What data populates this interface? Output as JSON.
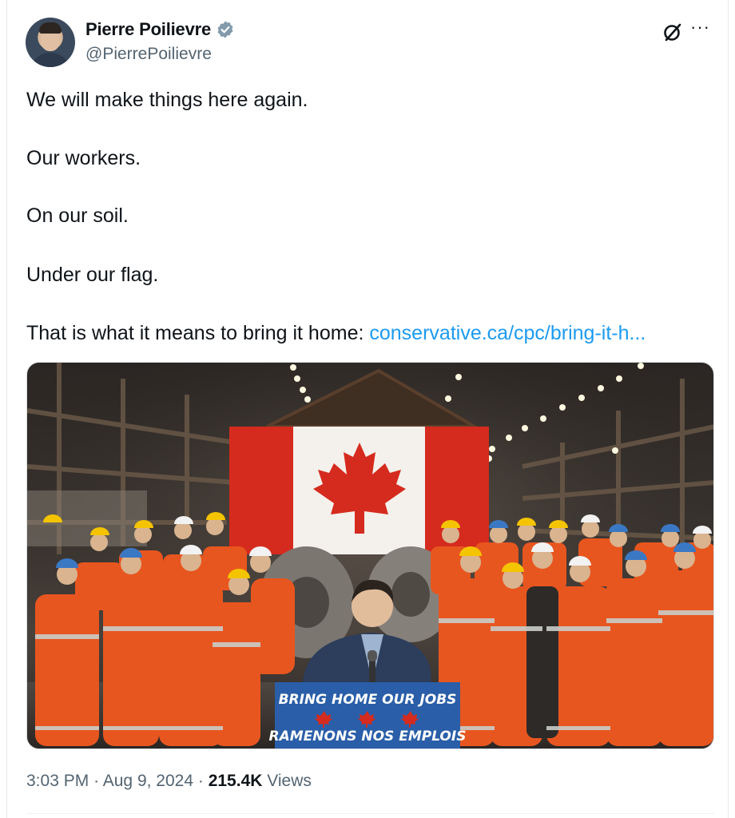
{
  "author": {
    "name": "Pierre Poilievre",
    "handle": "@PierrePoilievre",
    "verified": true
  },
  "tweet": {
    "lines": [
      "We will make things here again.",
      "Our workers.",
      "On our soil.",
      "Under our flag.",
      "That is what it means to bring it home:"
    ],
    "link_text": "conservative.ca/cpc/bring-it-h..."
  },
  "media": {
    "sign_line1": "BRING HOME OUR JOBS",
    "sign_line2": "RAMENONS NOS EMPLOIS"
  },
  "meta": {
    "time": "3:03 PM",
    "date": "Aug 9, 2024",
    "views_count": "215.4K",
    "views_label": "Views",
    "separator": "·"
  },
  "icons": {
    "grok": "grok-icon",
    "more": "more-icon",
    "verified": "verified-badge-icon"
  },
  "colors": {
    "link": "#1d9bf0",
    "secondary_text": "#536471",
    "verified_badge": "#829aab",
    "flag_red": "#d52b1e",
    "workwear_orange": "#e8561f",
    "sign_blue": "#2a5ea8"
  }
}
